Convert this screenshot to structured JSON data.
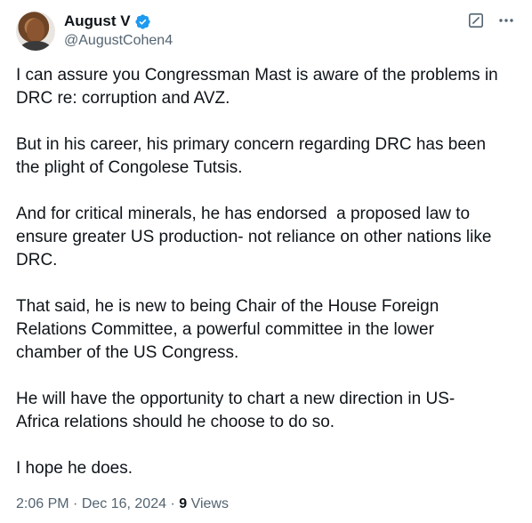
{
  "author": {
    "display_name": "August V",
    "handle": "@AugustCohen4",
    "verified": true
  },
  "tweet": {
    "paragraphs": [
      "I can assure you Congressman Mast is aware of the problems in\nDRC re: corruption and AVZ.",
      "But in his career, his primary concern regarding DRC has been\nthe plight of Congolese Tutsis.",
      "And for critical minerals, he has endorsed  a proposed law to\nensure greater US production- not reliance on other nations like\nDRC.",
      "That said, he is new to being Chair of the House Foreign\nRelations Committee, a powerful committee in the lower\nchamber of the US Congress.",
      "He will have the opportunity to chart a new direction in US-\nAfrica relations should he choose to do so.",
      "I hope he does."
    ]
  },
  "meta": {
    "time": "2:06 PM",
    "separator": " · ",
    "date": "Dec 16, 2024",
    "separator2": " · ",
    "views_count": "9",
    "views_label": " Views"
  },
  "icons": {
    "verified": "verified-badge-icon",
    "grok": "grok-icon",
    "more": "more-icon"
  },
  "colors": {
    "verified_blue": "#1d9bf0",
    "secondary_text": "#536471",
    "primary_text": "#0f1419"
  }
}
